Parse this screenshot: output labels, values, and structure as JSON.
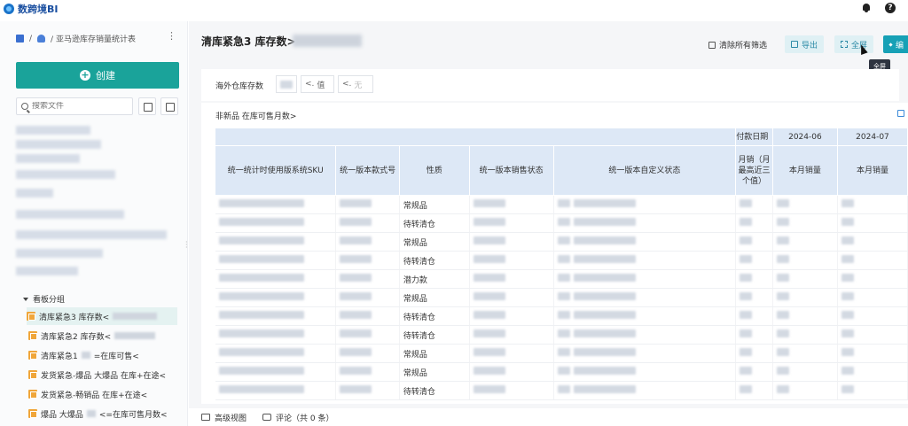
{
  "app": {
    "brand": "数跨境BI"
  },
  "sidebar": {
    "breadcrumb": [
      "/",
      "/ 亚马逊库存销量统计表"
    ],
    "create_label": "创建",
    "search_placeholder": "搜索文件",
    "tree_group": "看板分组",
    "items": [
      {
        "label": "清库紧急3 库存数<"
      },
      {
        "label": "清库紧急2 库存数<"
      },
      {
        "label": "清库紧急1",
        "suffix": "=在库可售<"
      },
      {
        "label": "发货紧急-爆品 大爆品 在库+在途<"
      },
      {
        "label": "发货紧急-畅销品 在库+在途<"
      },
      {
        "label": "爆品 大爆品",
        "suffix": "<=在库可售月数<"
      }
    ]
  },
  "main": {
    "title": "清库紧急3 库存数>",
    "clear_filters": "清除所有筛选",
    "export_label": "导出",
    "fullscreen_label": "全屏",
    "edit_label": "编",
    "tooltip": "全屏",
    "filter": {
      "label": "海外仓库存数",
      "op1": "值",
      "op2": "无"
    },
    "report_title": "非新品 在库可售月数>",
    "table": {
      "group_header": "付款日期",
      "month1": "2024-06",
      "month2": "2024-07",
      "headers": [
        "统一统计时使用版系统SKU",
        "统一版本款式号",
        "性质",
        "统一版本销售状态",
        "统一版本自定义状态",
        "月销（月最高近三个值）",
        "本月销量",
        "本月销量"
      ],
      "rows": [
        {
          "nature": "常规品"
        },
        {
          "nature": "待转清仓"
        },
        {
          "nature": "常规品"
        },
        {
          "nature": "待转清仓"
        },
        {
          "nature": "潜力款"
        },
        {
          "nature": "常规品"
        },
        {
          "nature": "待转清仓"
        },
        {
          "nature": "待转清仓"
        },
        {
          "nature": "常规品"
        },
        {
          "nature": "常规品"
        },
        {
          "nature": "待转清仓"
        }
      ]
    },
    "footer": {
      "advanced_view": "高级视图",
      "comments": "评论（共 0 条）"
    }
  }
}
